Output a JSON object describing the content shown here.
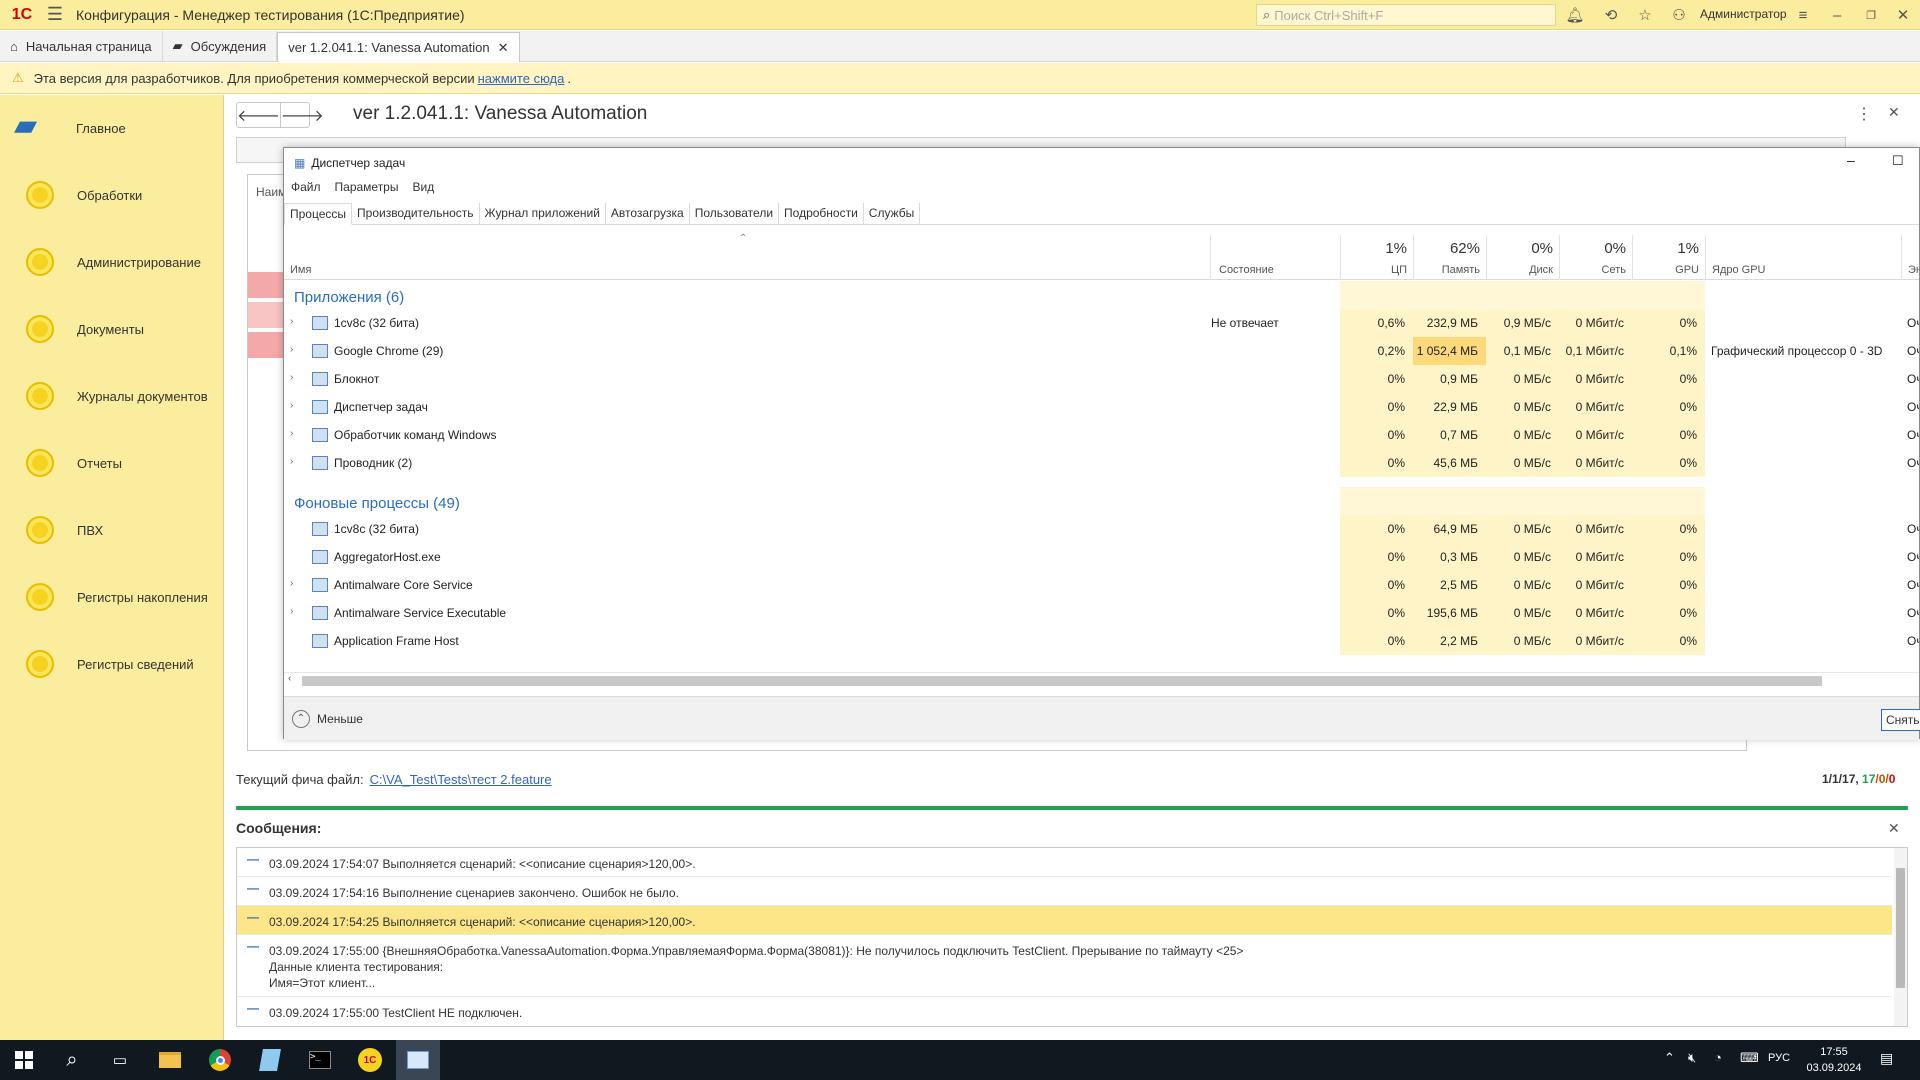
{
  "titlebar": {
    "title": "Конфигурация  - Менеджер тестирования (1С:Предприятие)",
    "logo": "1С",
    "search_placeholder": "Поиск Ctrl+Shift+F",
    "user": "Администратор"
  },
  "tabs": [
    {
      "label": "Начальная страница"
    },
    {
      "label": "Обсуждения"
    },
    {
      "label": "ver 1.2.041.1: Vanessa Automation"
    }
  ],
  "warning": {
    "text_before": "Эта версия для разработчиков. Для приобретения коммерческой версии",
    "link": "нажмите сюда",
    "text_after": "."
  },
  "sidebar": {
    "items": [
      {
        "label": "Главное"
      },
      {
        "label": "Обработки"
      },
      {
        "label": "Администрирование"
      },
      {
        "label": "Документы"
      },
      {
        "label": "Журналы документов"
      },
      {
        "label": "Отчеты"
      },
      {
        "label": "ПВХ"
      },
      {
        "label": "Регистры накопления"
      },
      {
        "label": "Регистры сведений"
      }
    ]
  },
  "page": {
    "title": "ver 1.2.041.1: Vanessa Automation",
    "bg_header": "Наим"
  },
  "taskmgr": {
    "title": "Диспетчер задач",
    "menu": [
      "Файл",
      "Параметры",
      "Вид"
    ],
    "tabs": [
      "Процессы",
      "Производительность",
      "Журнал приложений",
      "Автозагрузка",
      "Пользователи",
      "Подробности",
      "Службы"
    ],
    "columns": {
      "name": "Имя",
      "state": "Состояние",
      "cpu_pct": "1%",
      "cpu": "ЦП",
      "mem_pct": "62%",
      "mem": "Память",
      "disk_pct": "0%",
      "disk": "Диск",
      "net_pct": "0%",
      "net": "Сеть",
      "gpu_pct": "1%",
      "gpu": "GPU",
      "gpu_core": "Ядро GPU",
      "energy": "Эне"
    },
    "group_apps": "Приложения (6)",
    "group_bg": "Фоновые процессы (49)",
    "apps": [
      {
        "name": "1cv8c (32 бита)",
        "state": "Не отвечает",
        "cpu": "0,6%",
        "mem": "232,9 МБ",
        "disk": "0,9 МБ/с",
        "net": "0 Мбит/с",
        "gpu": "0%",
        "gpu_core": "",
        "energy": "Оче"
      },
      {
        "name": "Google Chrome (29)",
        "state": "",
        "cpu": "0,2%",
        "mem": "1 052,4 МБ",
        "disk": "0,1 МБ/с",
        "net": "0,1 Мбит/с",
        "gpu": "0,1%",
        "gpu_core": "Графический процессор 0 - 3D",
        "energy": "Оче"
      },
      {
        "name": "Блокнот",
        "state": "",
        "cpu": "0%",
        "mem": "0,9 МБ",
        "disk": "0 МБ/с",
        "net": "0 Мбит/с",
        "gpu": "0%",
        "gpu_core": "",
        "energy": "Оче"
      },
      {
        "name": "Диспетчер задач",
        "state": "",
        "cpu": "0%",
        "mem": "22,9 МБ",
        "disk": "0 МБ/с",
        "net": "0 Мбит/с",
        "gpu": "0%",
        "gpu_core": "",
        "energy": "Оче"
      },
      {
        "name": "Обработчик команд Windows",
        "state": "",
        "cpu": "0%",
        "mem": "0,7 МБ",
        "disk": "0 МБ/с",
        "net": "0 Мбит/с",
        "gpu": "0%",
        "gpu_core": "",
        "energy": "Оче"
      },
      {
        "name": "Проводник (2)",
        "state": "",
        "cpu": "0%",
        "mem": "45,6 МБ",
        "disk": "0 МБ/с",
        "net": "0 Мбит/с",
        "gpu": "0%",
        "gpu_core": "",
        "energy": "Оче"
      }
    ],
    "bg": [
      {
        "name": "1cv8c (32 бита)",
        "cpu": "0%",
        "mem": "64,9 МБ",
        "disk": "0 МБ/с",
        "net": "0 Мбит/с",
        "gpu": "0%",
        "energy": "Оче"
      },
      {
        "name": "AggregatorHost.exe",
        "cpu": "0%",
        "mem": "0,3 МБ",
        "disk": "0 МБ/с",
        "net": "0 Мбит/с",
        "gpu": "0%",
        "energy": "Оче"
      },
      {
        "name": "Antimalware Core Service",
        "cpu": "0%",
        "mem": "2,5 МБ",
        "disk": "0 МБ/с",
        "net": "0 Мбит/с",
        "gpu": "0%",
        "energy": "Оче"
      },
      {
        "name": "Antimalware Service Executable",
        "cpu": "0%",
        "mem": "195,6 МБ",
        "disk": "0 МБ/с",
        "net": "0 Мбит/с",
        "gpu": "0%",
        "energy": "Оче"
      },
      {
        "name": "Application Frame Host",
        "cpu": "0%",
        "mem": "2,2 МБ",
        "disk": "0 МБ/с",
        "net": "0 Мбит/с",
        "gpu": "0%",
        "energy": "Оче"
      }
    ],
    "less": "Меньше",
    "end_task": "Снять"
  },
  "feature": {
    "label": "Текущий фича файл:",
    "path": "C:\\VA_Test\\Tests\\тест 2.feature",
    "count_a": "1/1/17, ",
    "count_b": "17",
    "count_c": "/0/",
    "count_d": "0"
  },
  "messages": {
    "title": "Сообщения:",
    "items": [
      "03.09.2024 17:54:07 Выполняется сценарий: <<описание сценария>120,00>.",
      "03.09.2024 17:54:16 Выполнение сценариев закончено. Ошибок не было.",
      "03.09.2024 17:54:25 Выполняется сценарий: <<описание сценария>120,00>.",
      "03.09.2024 17:55:00 {ВнешняяОбработка.VanessaAutomation.Форма.УправляемаяФорма.Форма(38081)}: Не получилось подключить TestClient. Прерывание по таймауту <25>\nДанные клиента тестирования:\nИмя=Этот клиент...",
      "03.09.2024 17:55:00 TestClient НЕ подключен."
    ]
  },
  "taskbar": {
    "lang": "РУС",
    "time": "17:55",
    "date": "03.09.2024"
  }
}
